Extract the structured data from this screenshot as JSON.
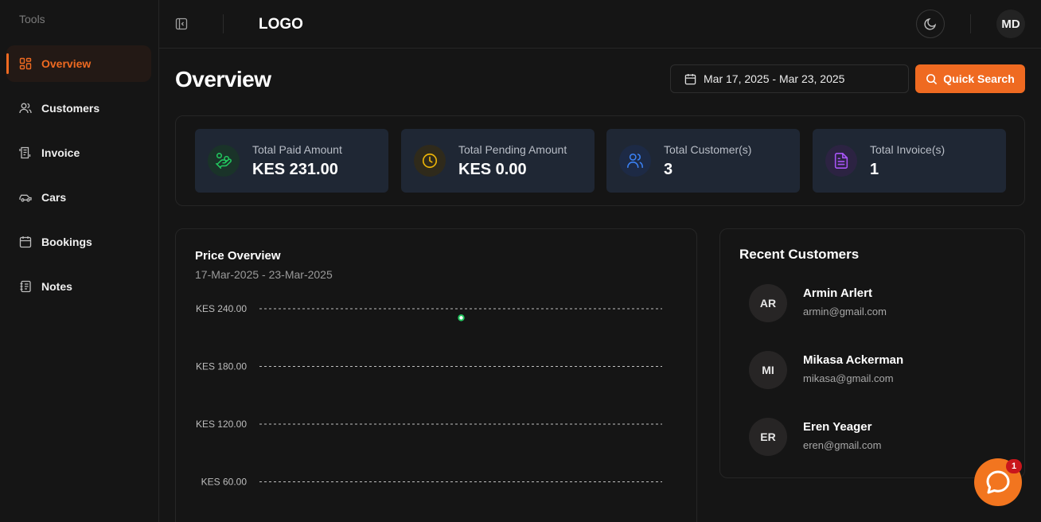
{
  "sidebar": {
    "heading": "Tools",
    "items": [
      {
        "label": "Overview",
        "icon": "dashboard-icon",
        "active": true
      },
      {
        "label": "Customers",
        "icon": "users-icon"
      },
      {
        "label": "Invoice",
        "icon": "receipt-icon"
      },
      {
        "label": "Cars",
        "icon": "car-icon"
      },
      {
        "label": "Bookings",
        "icon": "calendar-icon"
      },
      {
        "label": "Notes",
        "icon": "notebook-icon"
      }
    ]
  },
  "topbar": {
    "logo": "LOGO",
    "user_initials": "MD"
  },
  "header": {
    "title": "Overview",
    "date_range": "Mar 17, 2025 - Mar 23, 2025",
    "quick_search_label": "Quick Search"
  },
  "stats": [
    {
      "label": "Total Paid Amount",
      "value": "KES 231.00",
      "icon": "hand-coins-icon",
      "color": "#22c55e"
    },
    {
      "label": "Total Pending Amount",
      "value": "KES 0.00",
      "icon": "clock-icon",
      "color": "#eab308"
    },
    {
      "label": "Total Customer(s)",
      "value": "3",
      "icon": "users-icon",
      "color": "#3b82f6"
    },
    {
      "label": "Total Invoice(s)",
      "value": "1",
      "icon": "file-text-icon",
      "color": "#a855f7"
    }
  ],
  "price_overview": {
    "title": "Price Overview",
    "subtitle": "17-Mar-2025 - 23-Mar-2025"
  },
  "chart_data": {
    "type": "line",
    "title": "Price Overview",
    "subtitle": "17-Mar-2025 - 23-Mar-2025",
    "y_ticks": [
      "KES 240.00",
      "KES 180.00",
      "KES 120.00",
      "KES 60.00"
    ],
    "ylim": [
      0,
      240
    ],
    "grid": true,
    "points": [
      {
        "x_index": 3,
        "x_count": 7,
        "y": 231
      }
    ],
    "point_color": "#22c55e"
  },
  "recent_customers": {
    "title": "Recent Customers",
    "items": [
      {
        "initials": "AR",
        "name": "Armin Arlert",
        "email": "armin@gmail.com"
      },
      {
        "initials": "MI",
        "name": "Mikasa Ackerman",
        "email": "mikasa@gmail.com"
      },
      {
        "initials": "ER",
        "name": "Eren Yeager",
        "email": "eren@gmail.com"
      }
    ]
  },
  "chat": {
    "badge": "1"
  },
  "colors": {
    "accent": "#ef6a21",
    "card_bg": "#1f2734",
    "page_bg": "#151515"
  }
}
